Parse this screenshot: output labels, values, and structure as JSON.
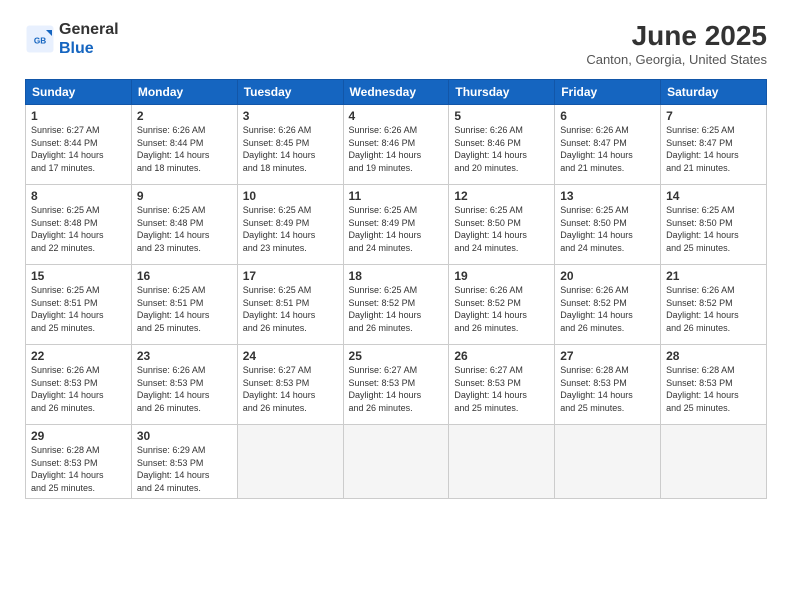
{
  "header": {
    "logo_general": "General",
    "logo_blue": "Blue",
    "month_title": "June 2025",
    "location": "Canton, Georgia, United States"
  },
  "columns": [
    "Sunday",
    "Monday",
    "Tuesday",
    "Wednesday",
    "Thursday",
    "Friday",
    "Saturday"
  ],
  "weeks": [
    [
      {
        "day": "1",
        "lines": [
          "Sunrise: 6:27 AM",
          "Sunset: 8:44 PM",
          "Daylight: 14 hours",
          "and 17 minutes."
        ]
      },
      {
        "day": "2",
        "lines": [
          "Sunrise: 6:26 AM",
          "Sunset: 8:44 PM",
          "Daylight: 14 hours",
          "and 18 minutes."
        ]
      },
      {
        "day": "3",
        "lines": [
          "Sunrise: 6:26 AM",
          "Sunset: 8:45 PM",
          "Daylight: 14 hours",
          "and 18 minutes."
        ]
      },
      {
        "day": "4",
        "lines": [
          "Sunrise: 6:26 AM",
          "Sunset: 8:46 PM",
          "Daylight: 14 hours",
          "and 19 minutes."
        ]
      },
      {
        "day": "5",
        "lines": [
          "Sunrise: 6:26 AM",
          "Sunset: 8:46 PM",
          "Daylight: 14 hours",
          "and 20 minutes."
        ]
      },
      {
        "day": "6",
        "lines": [
          "Sunrise: 6:26 AM",
          "Sunset: 8:47 PM",
          "Daylight: 14 hours",
          "and 21 minutes."
        ]
      },
      {
        "day": "7",
        "lines": [
          "Sunrise: 6:25 AM",
          "Sunset: 8:47 PM",
          "Daylight: 14 hours",
          "and 21 minutes."
        ]
      }
    ],
    [
      {
        "day": "8",
        "lines": [
          "Sunrise: 6:25 AM",
          "Sunset: 8:48 PM",
          "Daylight: 14 hours",
          "and 22 minutes."
        ]
      },
      {
        "day": "9",
        "lines": [
          "Sunrise: 6:25 AM",
          "Sunset: 8:48 PM",
          "Daylight: 14 hours",
          "and 23 minutes."
        ]
      },
      {
        "day": "10",
        "lines": [
          "Sunrise: 6:25 AM",
          "Sunset: 8:49 PM",
          "Daylight: 14 hours",
          "and 23 minutes."
        ]
      },
      {
        "day": "11",
        "lines": [
          "Sunrise: 6:25 AM",
          "Sunset: 8:49 PM",
          "Daylight: 14 hours",
          "and 24 minutes."
        ]
      },
      {
        "day": "12",
        "lines": [
          "Sunrise: 6:25 AM",
          "Sunset: 8:50 PM",
          "Daylight: 14 hours",
          "and 24 minutes."
        ]
      },
      {
        "day": "13",
        "lines": [
          "Sunrise: 6:25 AM",
          "Sunset: 8:50 PM",
          "Daylight: 14 hours",
          "and 24 minutes."
        ]
      },
      {
        "day": "14",
        "lines": [
          "Sunrise: 6:25 AM",
          "Sunset: 8:50 PM",
          "Daylight: 14 hours",
          "and 25 minutes."
        ]
      }
    ],
    [
      {
        "day": "15",
        "lines": [
          "Sunrise: 6:25 AM",
          "Sunset: 8:51 PM",
          "Daylight: 14 hours",
          "and 25 minutes."
        ]
      },
      {
        "day": "16",
        "lines": [
          "Sunrise: 6:25 AM",
          "Sunset: 8:51 PM",
          "Daylight: 14 hours",
          "and 25 minutes."
        ]
      },
      {
        "day": "17",
        "lines": [
          "Sunrise: 6:25 AM",
          "Sunset: 8:51 PM",
          "Daylight: 14 hours",
          "and 26 minutes."
        ]
      },
      {
        "day": "18",
        "lines": [
          "Sunrise: 6:25 AM",
          "Sunset: 8:52 PM",
          "Daylight: 14 hours",
          "and 26 minutes."
        ]
      },
      {
        "day": "19",
        "lines": [
          "Sunrise: 6:26 AM",
          "Sunset: 8:52 PM",
          "Daylight: 14 hours",
          "and 26 minutes."
        ]
      },
      {
        "day": "20",
        "lines": [
          "Sunrise: 6:26 AM",
          "Sunset: 8:52 PM",
          "Daylight: 14 hours",
          "and 26 minutes."
        ]
      },
      {
        "day": "21",
        "lines": [
          "Sunrise: 6:26 AM",
          "Sunset: 8:52 PM",
          "Daylight: 14 hours",
          "and 26 minutes."
        ]
      }
    ],
    [
      {
        "day": "22",
        "lines": [
          "Sunrise: 6:26 AM",
          "Sunset: 8:53 PM",
          "Daylight: 14 hours",
          "and 26 minutes."
        ]
      },
      {
        "day": "23",
        "lines": [
          "Sunrise: 6:26 AM",
          "Sunset: 8:53 PM",
          "Daylight: 14 hours",
          "and 26 minutes."
        ]
      },
      {
        "day": "24",
        "lines": [
          "Sunrise: 6:27 AM",
          "Sunset: 8:53 PM",
          "Daylight: 14 hours",
          "and 26 minutes."
        ]
      },
      {
        "day": "25",
        "lines": [
          "Sunrise: 6:27 AM",
          "Sunset: 8:53 PM",
          "Daylight: 14 hours",
          "and 26 minutes."
        ]
      },
      {
        "day": "26",
        "lines": [
          "Sunrise: 6:27 AM",
          "Sunset: 8:53 PM",
          "Daylight: 14 hours",
          "and 25 minutes."
        ]
      },
      {
        "day": "27",
        "lines": [
          "Sunrise: 6:28 AM",
          "Sunset: 8:53 PM",
          "Daylight: 14 hours",
          "and 25 minutes."
        ]
      },
      {
        "day": "28",
        "lines": [
          "Sunrise: 6:28 AM",
          "Sunset: 8:53 PM",
          "Daylight: 14 hours",
          "and 25 minutes."
        ]
      }
    ],
    [
      {
        "day": "29",
        "lines": [
          "Sunrise: 6:28 AM",
          "Sunset: 8:53 PM",
          "Daylight: 14 hours",
          "and 25 minutes."
        ]
      },
      {
        "day": "30",
        "lines": [
          "Sunrise: 6:29 AM",
          "Sunset: 8:53 PM",
          "Daylight: 14 hours",
          "and 24 minutes."
        ]
      },
      {
        "day": "",
        "lines": []
      },
      {
        "day": "",
        "lines": []
      },
      {
        "day": "",
        "lines": []
      },
      {
        "day": "",
        "lines": []
      },
      {
        "day": "",
        "lines": []
      }
    ]
  ]
}
